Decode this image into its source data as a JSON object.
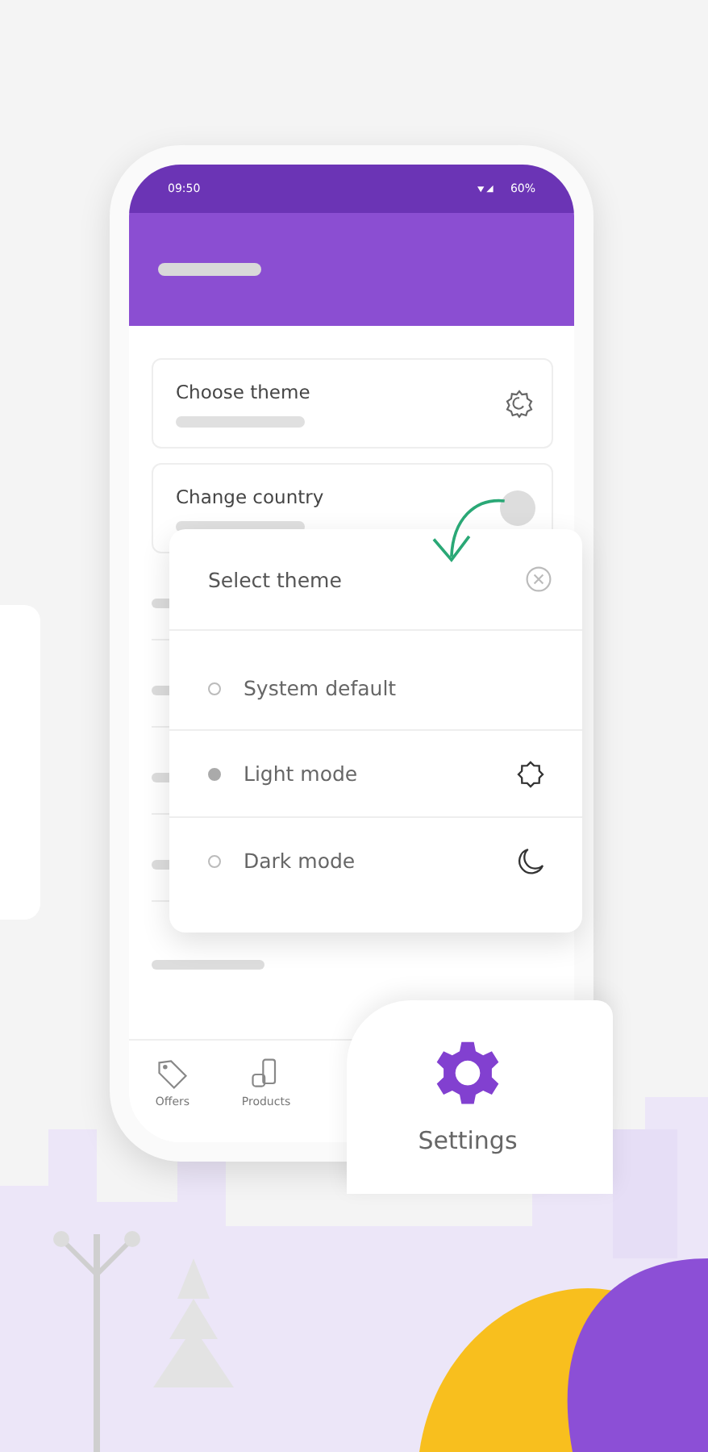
{
  "status_bar": {
    "time": "09:50",
    "battery": "60%"
  },
  "settings_list": [
    {
      "title": "Choose theme",
      "kind": "gear"
    },
    {
      "title": "Change country",
      "kind": "knob"
    }
  ],
  "dialog": {
    "title": "Select theme",
    "options": [
      {
        "label": "System default",
        "selected": false,
        "kind": "none"
      },
      {
        "label": "Light mode",
        "selected": true,
        "kind": "sun"
      },
      {
        "label": "Dark mode",
        "selected": false,
        "kind": "moon"
      }
    ]
  },
  "bottom_nav": [
    {
      "label": "Offers",
      "kind": "tag"
    },
    {
      "label": "Products",
      "kind": "products"
    }
  ],
  "settings_bubble": {
    "label": "Settings"
  }
}
